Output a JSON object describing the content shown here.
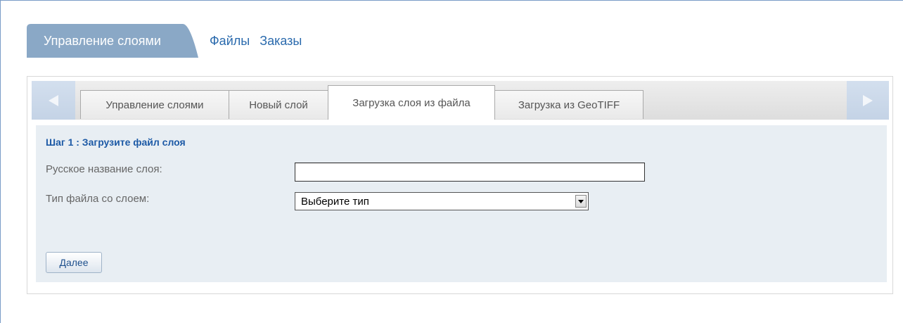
{
  "topnav": {
    "active": "Управление слоями",
    "links": [
      "Файлы",
      "Заказы"
    ]
  },
  "tabs": [
    {
      "label": "Управление слоями",
      "active": false
    },
    {
      "label": "Новый слой",
      "active": false
    },
    {
      "label": "Загрузка слоя из файла",
      "active": true
    },
    {
      "label": "Загрузка из GeoTIFF",
      "active": false
    }
  ],
  "form": {
    "step_title": "Шаг 1 : Загрузите файл слоя",
    "name_label": "Русское название слоя:",
    "name_value": "",
    "type_label": "Тип файла со слоем:",
    "type_selected": "Выберите тип",
    "next_button": "Далее"
  },
  "colors": {
    "accent": "#1d5aa6",
    "active_nav_bg": "#8aa8c6",
    "form_bg": "#e8eef3"
  },
  "icons": [
    "arrow-left-icon",
    "arrow-right-icon",
    "dropdown-arrow-icon"
  ]
}
